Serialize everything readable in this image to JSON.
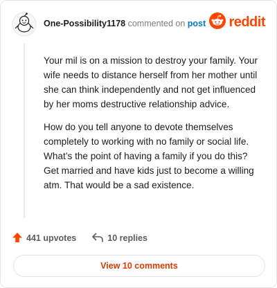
{
  "comment": {
    "username": "One-Possibility1178",
    "action_text": "commented on",
    "post_link": "post",
    "brand": "reddit",
    "paragraphs": [
      "Your mil is on a mission to destroy your family. Your wife needs to distance herself from her mother until she can think independently and not get influenced by her moms destructive relationship advice.",
      "How do you tell anyone to devote themselves completely to working with no family or social life. What’s the point of having a family if you do this? Get married and have kids just to become a willing atm. That would be a sad existence."
    ],
    "upvotes_label": "441 upvotes",
    "replies_label": "10 replies",
    "view_comments_label": "View 10 comments"
  },
  "colors": {
    "brand": "#ff4500",
    "link": "#0079d3",
    "upvote": "#ff4500",
    "view_button_text": "#d93a00"
  },
  "icons": {
    "avatar": "snoo-avatar-icon",
    "logo": "reddit-snoo-icon",
    "upvote": "upvote-arrow-icon",
    "reply": "reply-arrow-icon"
  }
}
